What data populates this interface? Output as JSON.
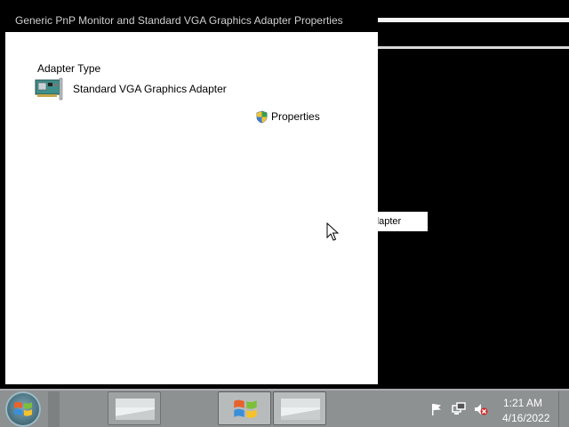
{
  "window": {
    "title": "Generic PnP Monitor and Standard VGA Graphics Adapter Properties"
  },
  "adapter_section": {
    "heading": "Adapter Type",
    "adapter_name": "Standard VGA Graphics Adapter",
    "properties_label": "Properties"
  },
  "background_window": {
    "partial_item_text": "dapter"
  },
  "taskbar": {
    "items": [
      "start",
      "window-1",
      "windows-explorer",
      "window-3"
    ],
    "clock": {
      "time": "1:21 AM",
      "date": "4/16/2022"
    },
    "tray_icons": [
      "action-center-flag-icon",
      "network-icon",
      "volume-muted-icon"
    ]
  }
}
